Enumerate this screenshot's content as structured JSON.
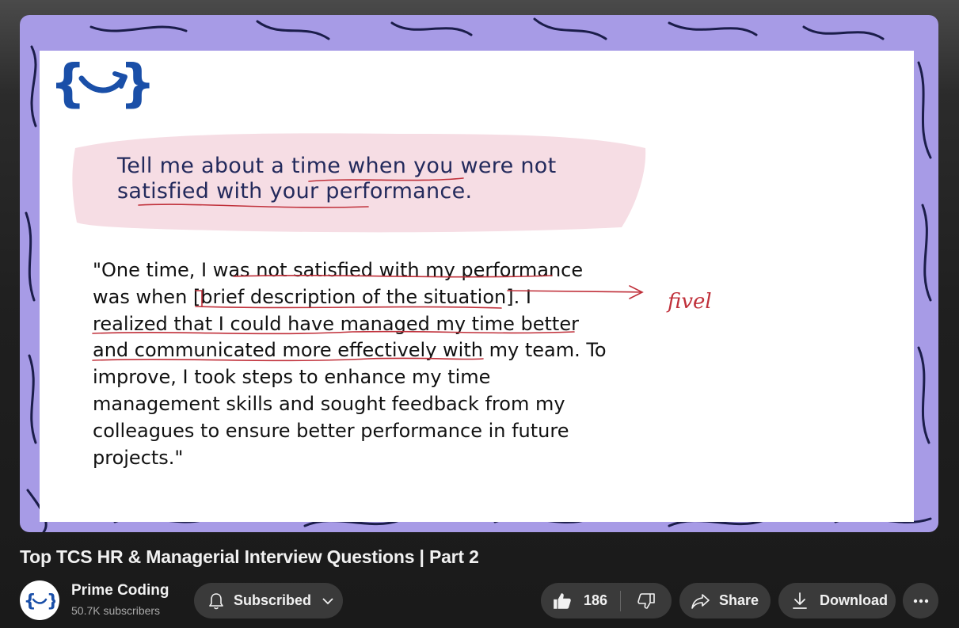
{
  "video": {
    "slide": {
      "question_line1": "Tell me about a time when you were not",
      "question_line2": "satisfied with your performance.",
      "answer_lines": [
        "\"One time, I was not satisfied with my performance",
        "was when [brief description of the situation]. I",
        "realized that I could have managed my time better",
        "and communicated more effectively with my team. To",
        "improve, I took steps to enhance my time",
        "management skills and sought feedback from my",
        "colleagues to ensure better performance in future",
        "projects.\""
      ],
      "annotation": "fivel"
    }
  },
  "title": "Top TCS HR & Managerial Interview Questions | Part 2",
  "channel": {
    "name": "Prime Coding",
    "subscribers": "50.7K subscribers",
    "avatar_icon": "curly-brace-arrow-logo"
  },
  "actions": {
    "subscribed_label": "Subscribed",
    "like_count": "186",
    "share_label": "Share",
    "download_label": "Download"
  },
  "colors": {
    "slide_border": "#a79be6",
    "logo_blue": "#1a4fa8",
    "question_highlight": "#f6dde4",
    "annotation_red": "#c0303a",
    "button_bg": "#3a3a3a"
  }
}
